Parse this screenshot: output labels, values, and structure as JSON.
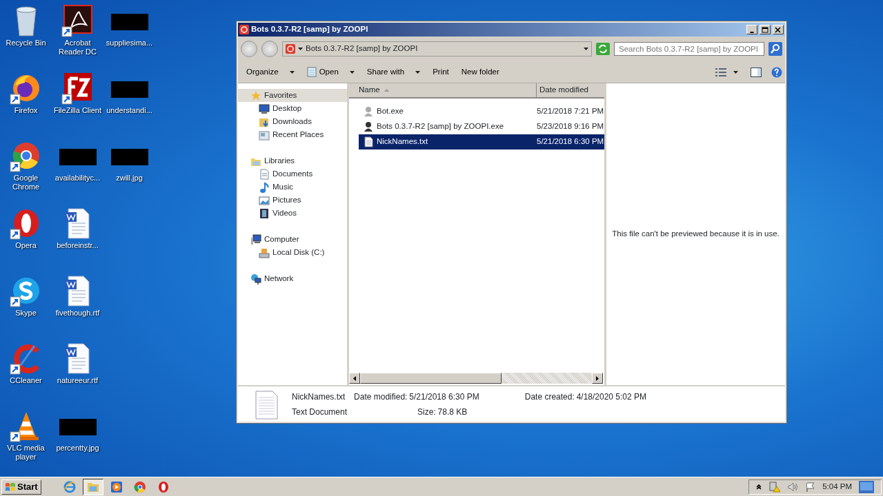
{
  "desktop_icons": [
    {
      "label": "Recycle Bin",
      "kind": "recycle",
      "shortcut": false
    },
    {
      "label": "Firefox",
      "kind": "firefox",
      "shortcut": true
    },
    {
      "label": "Google Chrome",
      "kind": "chrome",
      "shortcut": true
    },
    {
      "label": "Opera",
      "kind": "opera",
      "shortcut": true
    },
    {
      "label": "Skype",
      "kind": "skype",
      "shortcut": true
    },
    {
      "label": "CCleaner",
      "kind": "ccleaner",
      "shortcut": true
    },
    {
      "label": "VLC media player",
      "kind": "vlc",
      "shortcut": true
    },
    {
      "label": "Acrobat Reader DC",
      "kind": "acrobat",
      "shortcut": true
    },
    {
      "label": "FileZilla Client",
      "kind": "filezilla",
      "shortcut": true
    },
    {
      "label": "availabilityc...",
      "kind": "redacted",
      "shortcut": false
    },
    {
      "label": "beforeinstr...",
      "kind": "word",
      "shortcut": false
    },
    {
      "label": "fivethough.rtf",
      "kind": "word",
      "shortcut": false
    },
    {
      "label": "natureeur.rtf",
      "kind": "word",
      "shortcut": false
    },
    {
      "label": "percentty.jpg",
      "kind": "redacted",
      "shortcut": false
    },
    {
      "label": "suppliesima...",
      "kind": "redacted",
      "shortcut": false
    },
    {
      "label": "understandi...",
      "kind": "redacted",
      "shortcut": false
    },
    {
      "label": "zwill.jpg",
      "kind": "redacted",
      "shortcut": false
    }
  ],
  "window": {
    "title": "Bots 0.3.7-R2 [samp] by ZOOPI",
    "address": "Bots 0.3.7-R2 [samp] by ZOOPI",
    "search": {
      "placeholder": "Search Bots 0.3.7-R2 [samp] by ZOOPI"
    },
    "toolbar": [
      {
        "label": "Organize",
        "dropdown": true,
        "kind": "plain"
      },
      {
        "label": "Open",
        "dropdown": true,
        "kind": "open"
      },
      {
        "label": "Share with",
        "dropdown": true,
        "kind": "plain"
      },
      {
        "label": "Print",
        "dropdown": false,
        "kind": "plain"
      },
      {
        "label": "New folder",
        "dropdown": false,
        "kind": "plain"
      }
    ],
    "nav": [
      {
        "label": "Favorites",
        "kind": "star",
        "selected": true,
        "children": [
          {
            "label": "Desktop",
            "kind": "desktop",
            "selected": false
          },
          {
            "label": "Downloads",
            "kind": "downloads",
            "selected": false
          },
          {
            "label": "Recent Places",
            "kind": "recent",
            "selected": false
          }
        ]
      },
      {
        "label": "Libraries",
        "kind": "library",
        "selected": false,
        "children": [
          {
            "label": "Documents",
            "kind": "documents",
            "selected": false
          },
          {
            "label": "Music",
            "kind": "music",
            "selected": false
          },
          {
            "label": "Pictures",
            "kind": "pictures",
            "selected": false
          },
          {
            "label": "Videos",
            "kind": "videos",
            "selected": false
          }
        ]
      },
      {
        "label": "Computer",
        "kind": "computer",
        "selected": false,
        "children": [
          {
            "label": "Local Disk (C:)",
            "kind": "disk",
            "selected": false
          }
        ]
      },
      {
        "label": "Network",
        "kind": "network",
        "selected": false
      }
    ],
    "columns": [
      "Name",
      "Date modified"
    ],
    "files": [
      {
        "name": "Bot.exe",
        "date": "5/21/2018 7:21 PM",
        "kind": "app-light",
        "selected": false
      },
      {
        "name": "Bots 0.3.7-R2 [samp] by ZOOPI.exe",
        "date": "5/23/2018 9:16 PM",
        "kind": "app-dark",
        "selected": false
      },
      {
        "name": "NickNames.txt",
        "date": "5/21/2018 6:30 PM",
        "kind": "text",
        "selected": true
      }
    ],
    "preview_message": "This file can't be previewed because it is in use.",
    "details": {
      "name": "NickNames.txt",
      "type": "Text Document",
      "fields": [
        {
          "label": "Date modified:",
          "value": "5/21/2018 6:30 PM"
        },
        {
          "label": "Size:",
          "value": "78.8 KB"
        },
        {
          "label": "Date created:",
          "value": "4/18/2020 5:02 PM"
        }
      ]
    }
  },
  "taskbar": {
    "start": "Start",
    "items": [
      {
        "kind": "ie",
        "active": false
      },
      {
        "kind": "explorer",
        "active": true
      },
      {
        "kind": "media",
        "active": false
      },
      {
        "kind": "chrome",
        "active": false
      },
      {
        "kind": "opera",
        "active": false
      }
    ],
    "clock": "5:04 PM"
  }
}
